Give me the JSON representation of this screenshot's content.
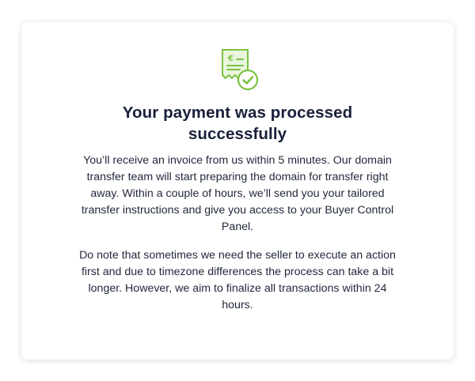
{
  "confirmation": {
    "icon": "receipt-check-icon",
    "accent_color": "#7cc242",
    "title_line1": "Your payment was processed",
    "title_line2": "successfully",
    "paragraph1": "You’ll receive an invoice from us within 5 minutes. Our domain transfer team will start preparing the domain for transfer right away. Within a couple of hours, we’ll send you your tailored transfer instructions and give you access to your Buyer Control Panel.",
    "paragraph2": "Do note that sometimes we need the seller to execute an action first and due to timezone differences the process can take a bit longer. However, we aim to finalize all transactions within 24 hours."
  }
}
